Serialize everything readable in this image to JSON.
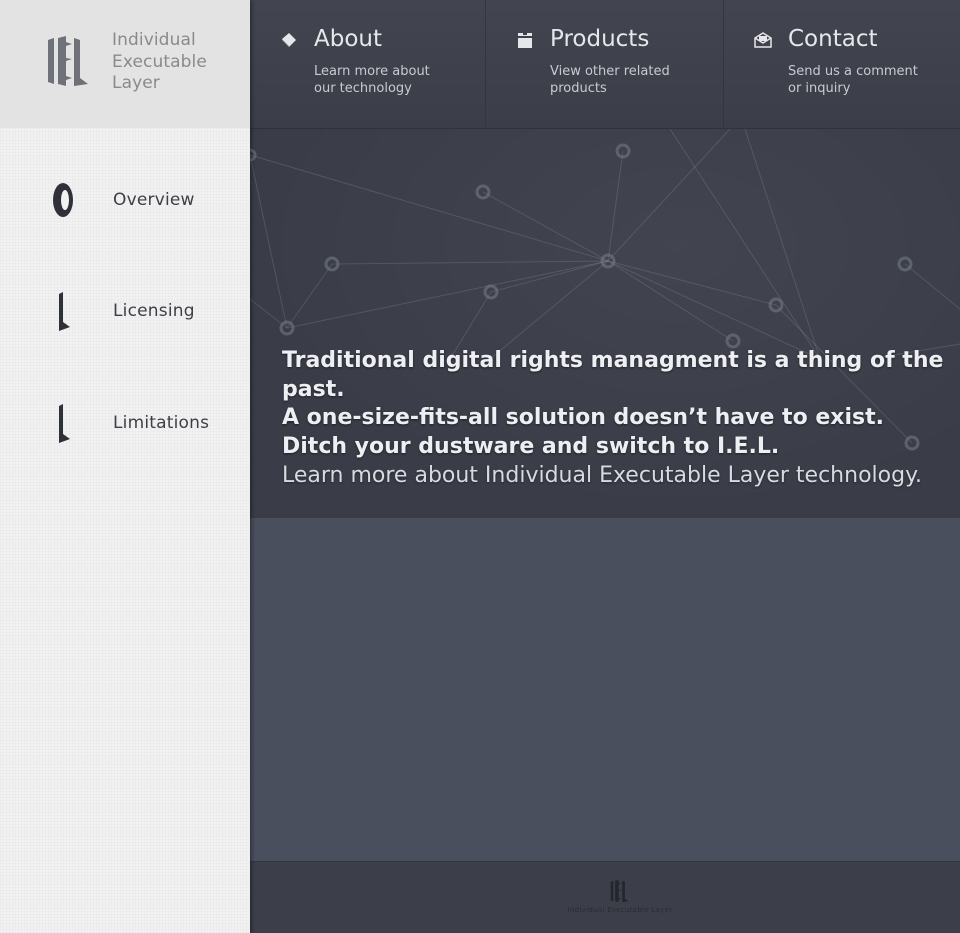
{
  "brand": {
    "name_lines": [
      "Individual",
      "Executable",
      "Layer"
    ],
    "logo_icon": "iel-logo-icon"
  },
  "sidebar": {
    "items": [
      {
        "label": "Overview",
        "icon": "overview-glyph-icon"
      },
      {
        "label": "Licensing",
        "icon": "licensing-glyph-icon"
      },
      {
        "label": "Limitations",
        "icon": "limitations-glyph-icon"
      }
    ]
  },
  "nav": {
    "items": [
      {
        "title": "About",
        "subtitle": "Learn more about our technology",
        "icon": "book-icon"
      },
      {
        "title": "Products",
        "subtitle": "View other related products",
        "icon": "box-icon"
      },
      {
        "title": "Contact",
        "subtitle": "Send us a comment or inquiry",
        "icon": "envelope-icon"
      }
    ]
  },
  "hero": {
    "lines": [
      "Traditional digital rights managment is a thing of the past.",
      "A one-size-fits-all solution doesn’t have to exist.",
      "Ditch your dustware and switch to I.E.L."
    ],
    "link_text": "Learn more about Individual Executable Layer technology."
  },
  "footer": {
    "text": "Individual Executable Layer",
    "logo_icon": "iel-footer-logo-icon"
  },
  "colors": {
    "sidebar_bg": "#f2f2f2",
    "brand_bg": "#e3e3e3",
    "nav_bg": "#3e414c",
    "hero_bg": "#3a3d48",
    "content_bg": "#4a4f5e",
    "footer_bg": "#3c3f4a"
  }
}
